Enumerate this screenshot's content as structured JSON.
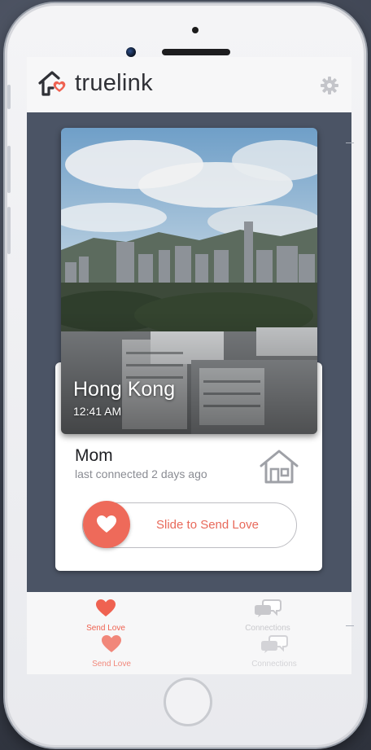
{
  "app": {
    "name": "truelink"
  },
  "header": {
    "brand": "truelink",
    "settings_icon": "gear-icon"
  },
  "location_card": {
    "city": "Hong Kong",
    "time": "12:41 AM"
  },
  "contact": {
    "name": "Mom",
    "status": "last connected 2 days ago",
    "icon": "house-icon"
  },
  "send_love_slider": {
    "label": "Slide to Send Love",
    "knob_icon": "heart-icon"
  },
  "tabs": [
    {
      "label": "Send Love",
      "icon": "heart-icon",
      "active": true
    },
    {
      "label": "Connections",
      "icon": "chat-bubbles-icon",
      "active": false
    }
  ],
  "colors": {
    "accent": "#ef6251",
    "header_bg": "#f7f7f8",
    "content_bg": "#4b5465"
  }
}
